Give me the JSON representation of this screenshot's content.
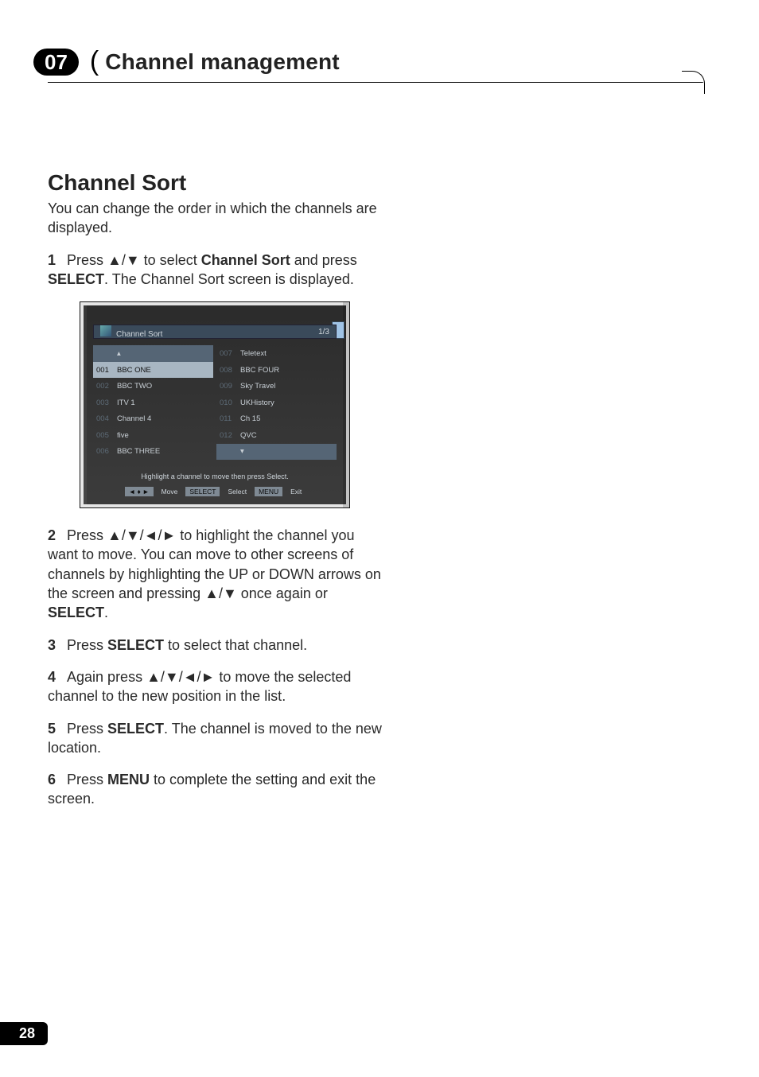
{
  "header": {
    "chapter_number": "07",
    "chapter_title": "Channel management"
  },
  "section": {
    "title": "Channel Sort",
    "intro": "You can change the order in which the channels are displayed."
  },
  "steps": {
    "s1": {
      "num": "1",
      "pre": "Press ",
      "arrows": "▲/▼",
      "mid": " to select ",
      "bold1": "Channel Sort",
      "post1": " and press ",
      "bold2": "SELECT",
      "tail": ". The Channel Sort screen is displayed."
    },
    "s2": {
      "num": "2",
      "pre": "Press ",
      "arrows": "▲/▼/◄/►",
      "mid": " to highlight the channel you want to move. You can move to other screens of channels by highlighting the UP or DOWN arrows on the screen and pressing ",
      "arrows2": "▲/▼",
      "post": " once again or ",
      "bold": "SELECT",
      "tail": "."
    },
    "s3": {
      "num": "3",
      "pre": "Press ",
      "bold": "SELECT",
      "tail": " to select that channel."
    },
    "s4": {
      "num": "4",
      "pre": "Again press ",
      "arrows": "▲/▼/◄/►",
      "tail": " to move the selected channel to the new position in the list."
    },
    "s5": {
      "num": "5",
      "pre": "Press ",
      "bold": "SELECT",
      "tail": ". The channel is moved to the new location."
    },
    "s6": {
      "num": "6",
      "pre": "Press ",
      "bold": "MENU",
      "tail": " to complete the setting and exit the screen."
    }
  },
  "osd": {
    "title": "Channel Sort",
    "page_indicator": "1/3",
    "hint": "Highlight a channel to move then press Select.",
    "buttons": {
      "move_key": "◄ ♦ ►",
      "move": "Move",
      "select_key": "SELECT",
      "select": "Select",
      "menu_key": "MENU",
      "menu": "Exit"
    },
    "left": [
      {
        "num": "",
        "name": "▴",
        "cls": "top"
      },
      {
        "num": "001",
        "name": "BBC ONE",
        "cls": "sel"
      },
      {
        "num": "002",
        "name": "BBC TWO"
      },
      {
        "num": "003",
        "name": "ITV 1"
      },
      {
        "num": "004",
        "name": "Channel 4"
      },
      {
        "num": "005",
        "name": "five"
      },
      {
        "num": "006",
        "name": "BBC THREE"
      }
    ],
    "right": [
      {
        "num": "007",
        "name": "Teletext"
      },
      {
        "num": "008",
        "name": "BBC FOUR"
      },
      {
        "num": "009",
        "name": "Sky Travel"
      },
      {
        "num": "010",
        "name": "UKHistory"
      },
      {
        "num": "011",
        "name": "Ch 15"
      },
      {
        "num": "012",
        "name": "QVC"
      },
      {
        "num": "",
        "name": "▾",
        "cls": "bot"
      }
    ]
  },
  "footer": {
    "page_number": "28"
  }
}
